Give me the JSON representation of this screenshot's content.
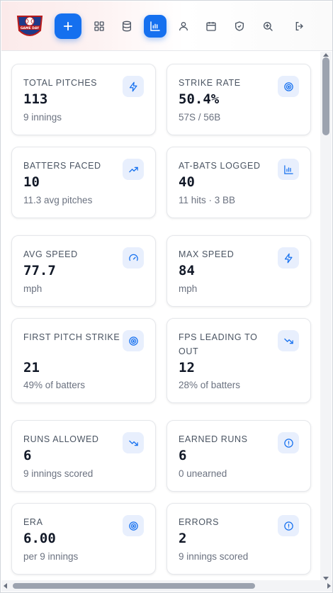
{
  "app": {
    "logo_text": "GAME DAY",
    "accent_color": "#1570ef"
  },
  "nav": {
    "items": [
      {
        "name": "add",
        "icon": "plus-icon",
        "active": false
      },
      {
        "name": "dashboard",
        "icon": "grid-icon",
        "active": false
      },
      {
        "name": "database",
        "icon": "database-icon",
        "active": false
      },
      {
        "name": "stats",
        "icon": "bar-chart-icon",
        "active": true
      },
      {
        "name": "player",
        "icon": "user-icon",
        "active": false
      },
      {
        "name": "schedule",
        "icon": "calendar-icon",
        "active": false
      },
      {
        "name": "security",
        "icon": "shield-check-icon",
        "active": false
      },
      {
        "name": "search",
        "icon": "zoom-in-icon",
        "active": false
      },
      {
        "name": "logout",
        "icon": "log-out-icon",
        "active": false
      }
    ]
  },
  "cards": [
    {
      "label": "TOTAL PITCHES",
      "value": "113",
      "sub": "9 innings",
      "icon": "zap-icon"
    },
    {
      "label": "STRIKE RATE",
      "value": "50.4%",
      "sub": "57S / 56B",
      "icon": "target-icon"
    },
    {
      "label": "BATTERS FACED",
      "value": "10",
      "sub": "11.3 avg pitches",
      "icon": "trending-up-icon"
    },
    {
      "label": "AT-BATS LOGGED",
      "value": "40",
      "sub": "11 hits · 3 BB",
      "icon": "bar-chart-icon"
    },
    {
      "label": "AVG SPEED",
      "value": "77.7",
      "sub": "mph",
      "icon": "gauge-icon"
    },
    {
      "label": "MAX SPEED",
      "value": "84",
      "sub": "mph",
      "icon": "zap-icon"
    },
    {
      "label": "FIRST PITCH STRIKE",
      "value": "21",
      "sub": "49% of batters",
      "icon": "target-icon"
    },
    {
      "label": "FPS LEADING TO OUT",
      "value": "12",
      "sub": "28% of batters",
      "icon": "trending-down-icon"
    },
    {
      "label": "RUNS ALLOWED",
      "value": "6",
      "sub": "9 innings scored",
      "icon": "trending-down-icon"
    },
    {
      "label": "EARNED RUNS",
      "value": "6",
      "sub": "0 unearned",
      "icon": "alert-circle-icon"
    },
    {
      "label": "ERA",
      "value": "6.00",
      "sub": "per 9 innings",
      "icon": "target-icon"
    },
    {
      "label": "ERRORS",
      "value": "2",
      "sub": "9 innings scored",
      "icon": "alert-circle-icon"
    }
  ]
}
